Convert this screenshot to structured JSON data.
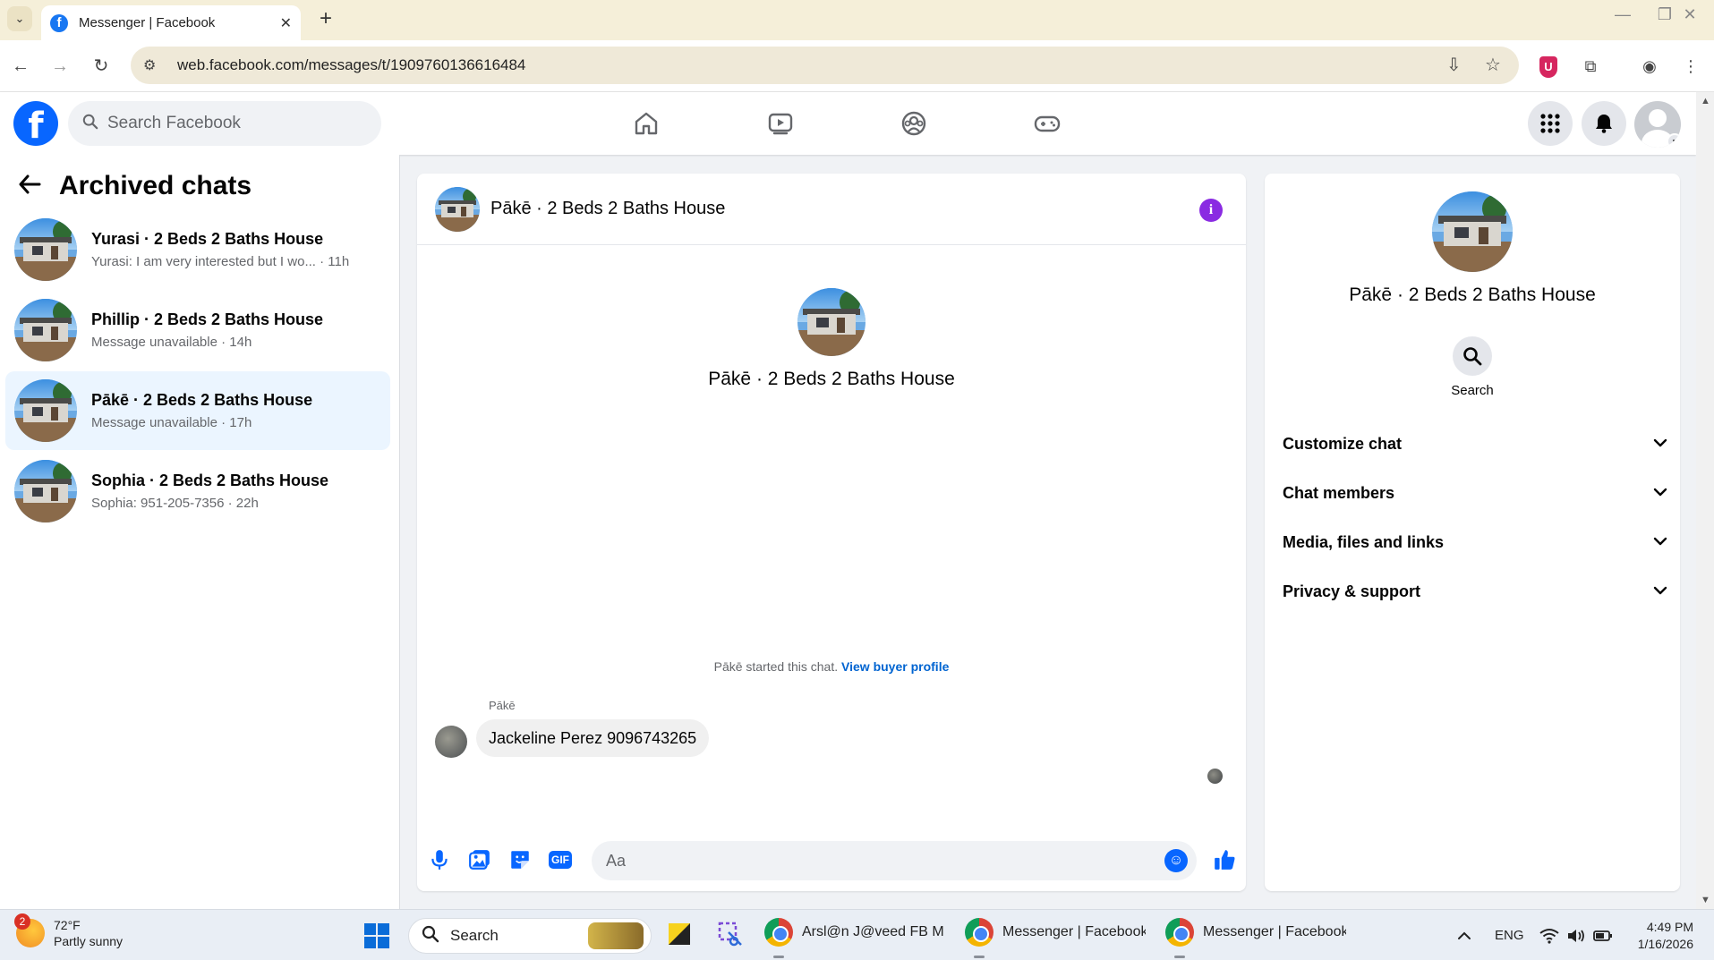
{
  "browser": {
    "tab_title": "Messenger | Facebook",
    "url": "web.facebook.com/messages/t/1909760136616484"
  },
  "fb_header": {
    "search_placeholder": "Search Facebook"
  },
  "left_panel": {
    "title": "Archived chats",
    "chats": [
      {
        "title": "Yurasi · 2 Beds 2 Baths House",
        "subtitle": "Yurasi: I am very interested but I wo... · 11h",
        "active": false
      },
      {
        "title": "Phillip · 2 Beds 2 Baths House",
        "subtitle": "Message unavailable · 14h",
        "active": false
      },
      {
        "title": "Pākē · 2 Beds 2 Baths House",
        "subtitle": "Message unavailable · 17h",
        "active": true
      },
      {
        "title": "Sophia · 2 Beds 2 Baths House",
        "subtitle": "Sophia: 951-205-7356 · 22h",
        "active": false
      }
    ]
  },
  "conversation": {
    "header_name": "Pākē · 2 Beds 2 Baths House",
    "intro_name": "Pākē · 2 Beds 2 Baths House",
    "started_text": "Pākē started this chat.",
    "buyer_profile_link": "View buyer profile",
    "sender_name": "Pākē",
    "message": "Jackeline Perez 9096743265",
    "composer_placeholder": "Aa",
    "gif_label": "GIF"
  },
  "info_panel": {
    "name": "Pākē · 2 Beds 2 Baths House",
    "search_label": "Search",
    "sections": [
      "Customize chat",
      "Chat members",
      "Media, files and links",
      "Privacy & support"
    ]
  },
  "taskbar": {
    "weather_badge": "2",
    "temperature": "72°F",
    "condition": "Partly sunny",
    "search_label": "Search",
    "windows": [
      "Arsl@n J@veed FB M@r",
      "Messenger | Facebook -",
      "Messenger | Facebook -"
    ],
    "language": "ENG",
    "time": "4:49 PM",
    "date": "1/16/2026"
  },
  "colors": {
    "fb_blue": "#0866ff",
    "active_chat_bg": "#ebf5ff",
    "link_blue": "#0064d1",
    "info_purple": "#8a2be2"
  }
}
